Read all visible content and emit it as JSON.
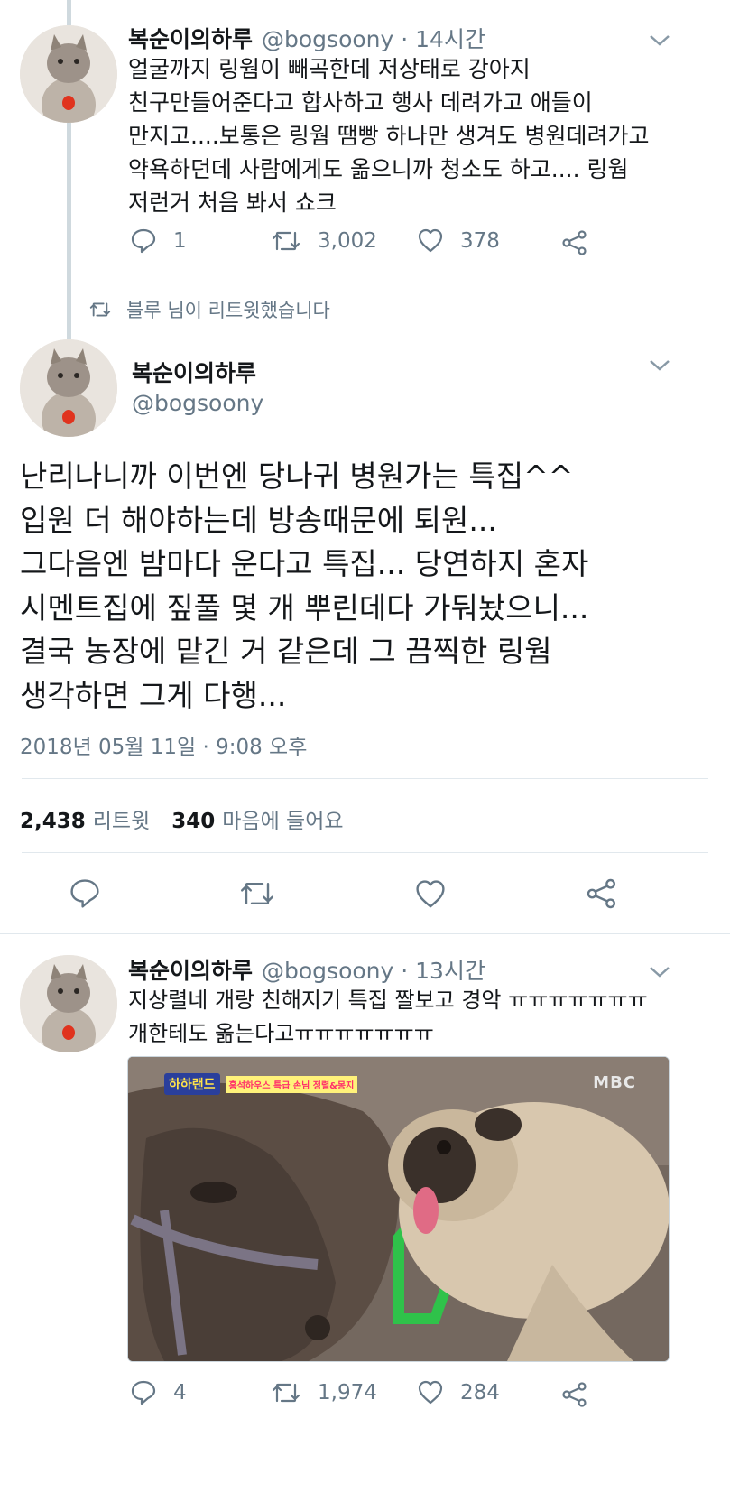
{
  "tweet1": {
    "name": "복순이의하루",
    "handle_time": "@bogsoony · 14시간",
    "text": "얼굴까지 링웜이 빼곡한데 저상태로 강아지\n친구만들어준다고 합사하고 행사 데려가고 애들이\n만지고....보통은 링웜 땜빵 하나만 생겨도 병원데려가고\n약욕하던데 사람에게도 옮으니까 청소도 하고.... 링웜\n저런거 처음 봐서 쇼크",
    "reply_count": "1",
    "retweet_count": "3,002",
    "like_count": "378"
  },
  "retweet_notice": "블루 님이 리트윗했습니다",
  "tweet2": {
    "name": "복순이의하루",
    "handle": "@bogsoony",
    "text": "난리나니까 이번엔 당나귀 병원가는 특집^^\n입원 더 해야하는데 방송때문에 퇴원...\n그다음엔 밤마다 운다고 특집... 당연하지 혼자\n시멘트집에 짚풀 몇 개 뿌린데다 가둬놨으니...\n결국 농장에 맡긴 거 같은데 그 끔찍한 링웜\n생각하면 그게 다행...",
    "timestamp": "2018년 05월 11일 · 9:08 오후",
    "retweets_num": "2,438",
    "retweets_label": "리트윗",
    "likes_num": "340",
    "likes_label": "마음에 들어요"
  },
  "tweet3": {
    "name": "복순이의하루",
    "handle_time": "@bogsoony · 13시간",
    "text": "지상렬네 개랑 친해지기 특집 짤보고 경악 ㅠㅠㅠㅠㅠㅠㅠ\n개한테도 옮는다고ㅠㅠㅠㅠㅠㅠㅠ",
    "media_logo": "하하랜드",
    "media_caption": "홍석하우스 특급 손님 정렬&몽지",
    "media_watermark": "MBC",
    "reply_count": "4",
    "retweet_count": "1,974",
    "like_count": "284"
  },
  "colors": {
    "text": "#14171a",
    "secondary": "#657786",
    "divider": "#e1e8ed",
    "thread_line": "#cfd9de"
  },
  "icons": [
    "reply-icon",
    "retweet-icon",
    "like-icon",
    "share-icon",
    "chevron-down-icon"
  ]
}
